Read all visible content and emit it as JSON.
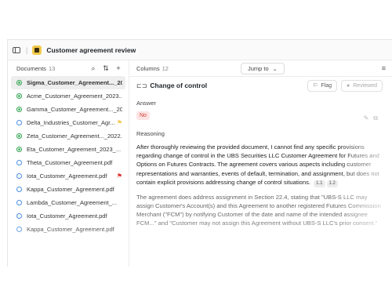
{
  "window": {
    "title": "Customer agreement review"
  },
  "sidebar": {
    "label": "Documents",
    "count": "13",
    "documents": [
      {
        "name": "Sigma_Customer_Agreement..._20...",
        "status": "done",
        "flag": ""
      },
      {
        "name": "Acme_Customer_Agreement_2023....",
        "status": "done",
        "flag": ""
      },
      {
        "name": "Gamma_Customer_Agreement..._20...",
        "status": "done",
        "flag": ""
      },
      {
        "name": "Delta_Industries_Customer_Agr...",
        "status": "pending",
        "flag": "yellow"
      },
      {
        "name": "Zeta_Customer_Agreement..._2022...",
        "status": "done",
        "flag": ""
      },
      {
        "name": "Eta_Customer_Agreement_2023_...",
        "status": "done",
        "flag": ""
      },
      {
        "name": "Theta_Customer_Agreement.pdf",
        "status": "pending",
        "flag": ""
      },
      {
        "name": "Iota_Customer_Agreement.pdf",
        "status": "pending",
        "flag": "red"
      },
      {
        "name": "Kappa_Customer_Agreement.pdf",
        "status": "pending",
        "flag": ""
      },
      {
        "name": "Lambda_Customer_Agreement_...",
        "status": "pending",
        "flag": ""
      },
      {
        "name": "Iota_Customer_Agreement.pdf",
        "status": "pending",
        "flag": ""
      },
      {
        "name": "Kappa_Customer_Agreement.pdf",
        "status": "pending",
        "flag": ""
      }
    ]
  },
  "topbar": {
    "columns_label": "Columns",
    "columns_count": "12",
    "jump_label": "Jump to"
  },
  "main": {
    "column_title": "Change of control",
    "flag_label": "Flag",
    "reviewed_label": "Reviewed",
    "answer_label": "Answer",
    "answer_value": "No",
    "reasoning_label": "Reasoning",
    "reasoning_p1": "After thoroughly reviewing the provided document, I cannot find any specific provisions regarding change of control in the UBS Securities LLC Customer Agreement for Futures and Options on Futures Contracts. The agreement covers various aspects including customer representations and warranties, events of default, termination, and assignment, but does not contain explicit provisions addressing change of control situations.",
    "cite_1": "1.1",
    "cite_2": "1.2",
    "reasoning_p2": "The agreement does address assignment in Section 22.4, stating that \"UBS-S LLC may assign Customer's Account(s) and this Agreement to another registered Futures Commission Merchant (\"FCM\") by notifying Customer of the date and name of the intended assignee FCM...\" and \"Customer may not assign this Agreement without UBS-S LLC's prior consent.\""
  },
  "colors": {
    "done": "#2ea44f",
    "pending": "#4a90e2",
    "flag_yellow": "#f2c94c",
    "flag_red": "#e03131",
    "no_badge": "#d43b3b"
  }
}
